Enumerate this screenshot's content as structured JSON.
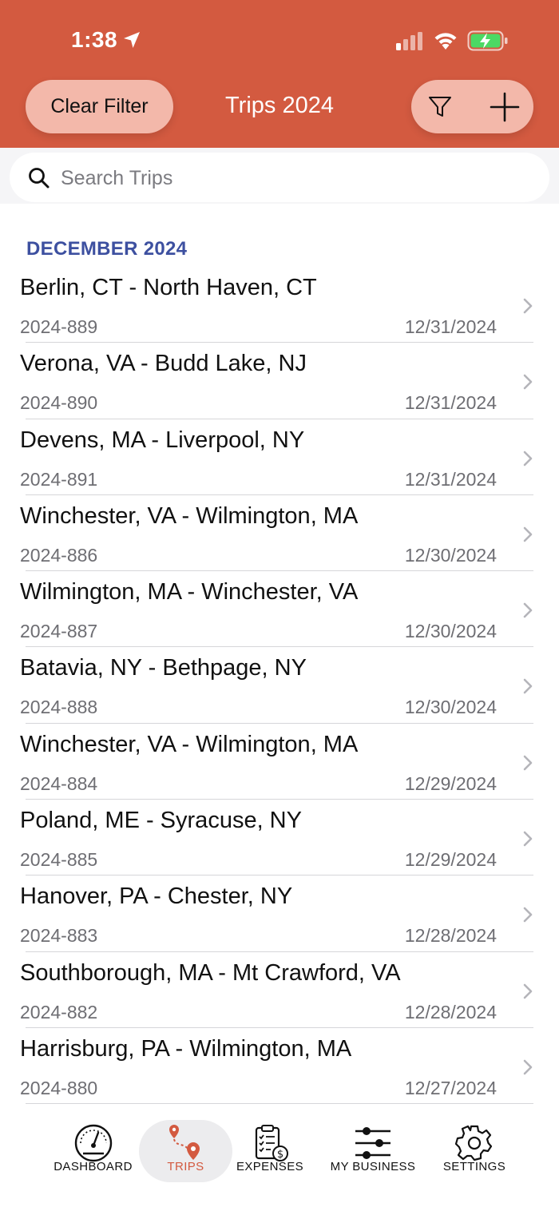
{
  "status": {
    "time": "1:38"
  },
  "header": {
    "title": "Trips 2024",
    "clear_filter": "Clear Filter"
  },
  "search": {
    "placeholder": "Search Trips"
  },
  "section": {
    "title": "DECEMBER 2024"
  },
  "trips": [
    {
      "route": "Berlin, CT - North Haven, CT",
      "id": "2024-889",
      "date": "12/31/2024"
    },
    {
      "route": "Verona, VA - Budd Lake, NJ",
      "id": "2024-890",
      "date": "12/31/2024"
    },
    {
      "route": "Devens, MA - Liverpool, NY",
      "id": "2024-891",
      "date": "12/31/2024"
    },
    {
      "route": "Winchester, VA - Wilmington, MA",
      "id": "2024-886",
      "date": "12/30/2024"
    },
    {
      "route": "Wilmington, MA - Winchester, VA",
      "id": "2024-887",
      "date": "12/30/2024"
    },
    {
      "route": "Batavia, NY - Bethpage, NY",
      "id": "2024-888",
      "date": "12/30/2024"
    },
    {
      "route": "Winchester, VA - Wilmington, MA",
      "id": "2024-884",
      "date": "12/29/2024"
    },
    {
      "route": "Poland, ME - Syracuse, NY",
      "id": "2024-885",
      "date": "12/29/2024"
    },
    {
      "route": "Hanover, PA - Chester, NY",
      "id": "2024-883",
      "date": "12/28/2024"
    },
    {
      "route": "Southborough, MA - Mt Crawford, VA",
      "id": "2024-882",
      "date": "12/28/2024"
    },
    {
      "route": "Harrisburg, PA - Wilmington, MA",
      "id": "2024-880",
      "date": "12/27/2024"
    }
  ],
  "tabs": {
    "dashboard": "DASHBOARD",
    "trips": "TRIPS",
    "expenses": "EXPENSES",
    "my_business": "MY BUSINESS",
    "settings": "SETTINGS"
  },
  "colors": {
    "brand": "#d35a40",
    "pill": "#f3b8aa",
    "section": "#3d50a0",
    "battery": "#4cd964"
  },
  "icons": [
    "location-arrow-icon",
    "signal-icon",
    "wifi-icon",
    "battery-charging-icon",
    "filter-icon",
    "plus-icon",
    "search-icon",
    "chevron-right-icon",
    "dashboard-gauge-icon",
    "trips-route-icon",
    "expenses-clipboard-icon",
    "my-business-sliders-icon",
    "settings-gear-icon"
  ]
}
